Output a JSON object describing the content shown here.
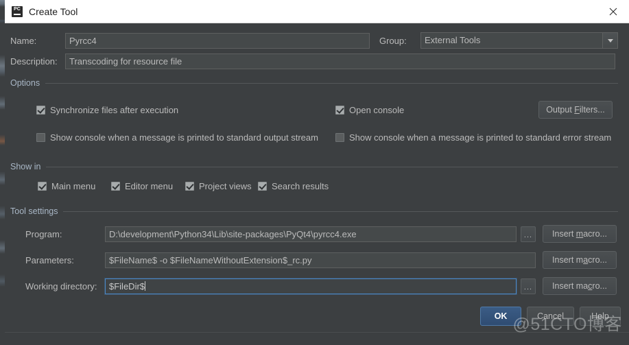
{
  "window": {
    "title": "Create Tool",
    "icon": "pycharm-icon",
    "close_label": "✕"
  },
  "fields": {
    "name_label": "Name:",
    "name_value": "Pyrcc4",
    "group_label": "Group:",
    "group_value": "External Tools",
    "description_label": "Description:",
    "description_value": "Transcoding for resource file"
  },
  "options": {
    "title": "Options",
    "checkboxes": [
      {
        "label": "Synchronize files after execution",
        "checked": true
      },
      {
        "label": "Open console",
        "checked": true
      },
      {
        "label": "Show console when a message is printed to standard output stream",
        "checked": false
      },
      {
        "label": "Show console when a message is printed to standard error stream",
        "checked": false
      }
    ],
    "output_filters_button": "Output Filters...",
    "output_filters_mnemonic": "F"
  },
  "show_in": {
    "title": "Show in",
    "checkboxes": [
      {
        "label": "Main menu",
        "checked": true
      },
      {
        "label": "Editor menu",
        "checked": true
      },
      {
        "label": "Project views",
        "checked": true
      },
      {
        "label": "Search results",
        "checked": true
      }
    ]
  },
  "tool_settings": {
    "title": "Tool settings",
    "rows": [
      {
        "label": "Program:",
        "value": "D:\\development\\Python34\\Lib\\site-packages\\PyQt4\\pyrcc4.exe",
        "has_browse": true,
        "browse_label": "...",
        "macro_button": "Insert macro...",
        "macro_mnemonic": "m",
        "focused": false
      },
      {
        "label": "Parameters:",
        "value": "$FileName$ -o $FileNameWithoutExtension$_rc.py",
        "has_browse": false,
        "browse_label": "",
        "macro_button": "Insert macro...",
        "macro_mnemonic": "a",
        "focused": false
      },
      {
        "label": "Working directory:",
        "value": "$FileDir$",
        "has_browse": true,
        "browse_label": "...",
        "macro_button": "Insert macro...",
        "macro_mnemonic": "c",
        "focused": true
      }
    ]
  },
  "footer": {
    "ok": "OK",
    "cancel": "Cancel",
    "help": "Help"
  },
  "watermark": "@51CTO博客",
  "colors": {
    "dialog_bg": "#3c3f41",
    "input_bg": "#45494a",
    "text": "#bbbbbb",
    "accent": "#4a88c7",
    "ok_button": "#36557c",
    "titlebar_bg": "#ffffff"
  }
}
